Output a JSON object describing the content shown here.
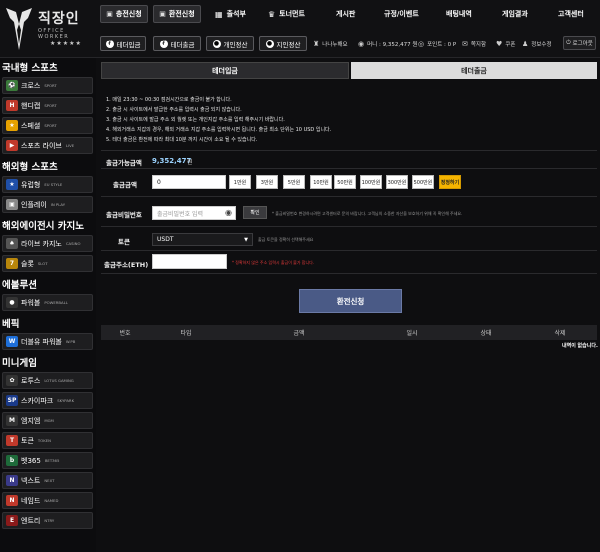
{
  "brand": {
    "title": "직장인",
    "subtitle": "OFFICE WORKER",
    "stars": "★★★★★"
  },
  "header": {
    "deposit_btn": "충전신청",
    "withdraw_btn": "환전신청",
    "nav": [
      {
        "icon": "calendar-icon",
        "label": "출석부"
      },
      {
        "icon": "trophy-icon",
        "label": "토너먼트"
      },
      {
        "icon": "",
        "label": "게시판"
      },
      {
        "icon": "",
        "label": "규정/이벤트"
      },
      {
        "icon": "",
        "label": "배팅내역"
      },
      {
        "icon": "",
        "label": "게임결과"
      },
      {
        "icon": "",
        "label": "고객센터"
      }
    ],
    "sub": [
      "테더입금",
      "테더출금",
      "개인정산",
      "지인정산"
    ],
    "user": {
      "name": "나나누해요",
      "money_label": "머니 : 9,352,477 원",
      "point_label": "포인트 : 0 P",
      "notes": "쪽지함",
      "coupon": "쿠폰",
      "info": "정보수정",
      "logout": "로그아웃"
    }
  },
  "sidebar": {
    "sections": [
      {
        "title": "국내형 스포츠",
        "items": [
          {
            "name": "크로스",
            "en": "SPORT",
            "icon_color": "#3a7a3a",
            "icon_text": "⚽"
          },
          {
            "name": "핸디캡",
            "en": "SPORT",
            "icon_color": "#c0392b",
            "icon_text": "H"
          },
          {
            "name": "스페셜",
            "en": "SPORT",
            "icon_color": "#e6a100",
            "icon_text": "★"
          },
          {
            "name": "스포츠 라이브",
            "en": "LIVE",
            "icon_color": "#c0392b",
            "icon_text": "▶"
          }
        ]
      },
      {
        "title": "해외형 스포츠",
        "items": [
          {
            "name": "유럽형",
            "en": "EU STYLE",
            "icon_color": "#1f4fa8",
            "icon_text": "★"
          },
          {
            "name": "인플레이",
            "en": "IN PLAY",
            "icon_color": "#888888",
            "icon_text": "▣"
          }
        ]
      },
      {
        "title": "해외에이전시 카지노",
        "items": [
          {
            "name": "라이브 카지노",
            "en": "CASINO",
            "icon_color": "#555555",
            "icon_text": "♠"
          },
          {
            "name": "슬롯",
            "en": "SLOT",
            "icon_color": "#b8860b",
            "icon_text": "7"
          }
        ]
      },
      {
        "title": "에볼루션",
        "items": [
          {
            "name": "파워볼",
            "en": "POWERBALL",
            "icon_color": "#333333",
            "icon_text": "●"
          }
        ]
      },
      {
        "title": "베픽",
        "items": [
          {
            "name": "더블유 파워볼",
            "en": "W.PB",
            "icon_color": "#1e6fd9",
            "icon_text": "W"
          }
        ]
      },
      {
        "title": "미니게임",
        "items": [
          {
            "name": "로투스",
            "en": "LOTUS GAMING",
            "icon_color": "#333333",
            "icon_text": "✿"
          },
          {
            "name": "스카이파크",
            "en": "SKYPARK",
            "icon_color": "#1a3a8a",
            "icon_text": "SP"
          },
          {
            "name": "엠지엠",
            "en": "MGM",
            "icon_color": "#333333",
            "icon_text": "M"
          },
          {
            "name": "토큰",
            "en": "TOKEN",
            "icon_color": "#c0392b",
            "icon_text": "T"
          },
          {
            "name": "벳365",
            "en": "BET365",
            "icon_color": "#1e6b3a",
            "icon_text": "b"
          },
          {
            "name": "넥스트",
            "en": "NEXT",
            "icon_color": "#3a3a8a",
            "icon_text": "N"
          },
          {
            "name": "네임드",
            "en": "NAMED",
            "icon_color": "#c0392b",
            "icon_text": "N"
          },
          {
            "name": "엔트리",
            "en": "NTRY",
            "icon_color": "#8a1a1a",
            "icon_text": "E"
          }
        ]
      }
    ]
  },
  "main": {
    "tab_deposit": "테더입금",
    "tab_withdraw": "테더출금",
    "notices": [
      "1. 매일 23:30 ~ 00:30 점검시간으로 출금이 불가 합니다.",
      "2. 출금 시 사이트에서 발급한 주소를 입력시 출금 되지 않습니다.",
      "3. 출금 시 사이트에 발급 주소 외 월렛 또는 개인지갑 주소를 입력 해주시기 바랍니다.",
      "4. 해외거래소 지갑의 경우, 해외 거래소 지갑 주소를 입력하시면 됩니다. 출금 최소 단위는 10 USD 입니다.",
      "5. 테더 출금은 환전에 따라 최대 10분 까지 시간이 소요 될 수 있습니다."
    ],
    "available_label": "출금가능금액",
    "available_value": "9,352,477",
    "available_unit": "원",
    "amount_label": "출금금액",
    "amount_value": "0",
    "chips": [
      "1만원",
      "3만원",
      "5만원",
      "10만원",
      "50만원",
      "100만원",
      "300만원",
      "500만원"
    ],
    "reset": "정정하기",
    "pw_label": "출금비밀번호",
    "pw_placeholder": "출금비밀번호 입력",
    "confirm": "확인",
    "pw_hint": "* 출금비밀번호 변경하시려면 고객센터로 문의 바랍니다. 고객님의 소중한 자산을 보호하기 위해 꼭 확인해 주세요.",
    "token_label": "토큰",
    "token_value": "USDT",
    "token_hint": "출금 토큰을 정확히 선택해주세요",
    "address_label": "출금주소(ETH)",
    "address_hint": "* 정확하지 않은 주소 입력시 출금이 불가 합니다.",
    "submit": "환전신청",
    "table_headers": [
      "번호",
      "타입",
      "금액",
      "일시",
      "상태",
      "삭제"
    ],
    "empty": "내역이 없습니다."
  }
}
